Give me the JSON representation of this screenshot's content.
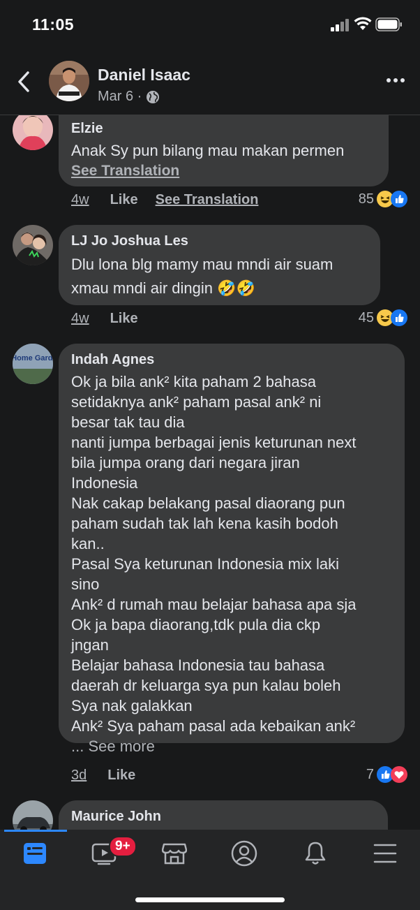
{
  "status": {
    "time": "11:05"
  },
  "header": {
    "name": "Daniel Isaac",
    "date": "Mar 6 ·"
  },
  "comments": [
    {
      "author": "Elzie",
      "text": "Anak Sy pun bilang mau makan permen",
      "see_translation": "See Translation",
      "time": "4w",
      "like": "Like",
      "translate": "See Translation",
      "reactions": "85"
    },
    {
      "author": "LJ Jo Joshua Les",
      "text": "Dlu lona blg  mamy mau mndi air suam\nxmau mndi air dingin 🤣🤣",
      "time": "4w",
      "like": "Like",
      "reactions": "45"
    },
    {
      "author": "Indah Agnes",
      "text": "Ok ja bila ank² kita paham 2 bahasa\nsetidaknya ank² paham pasal ank² ni\nbesar tak tau dia\nnanti jumpa berbagai jenis keturunan next\nbila jumpa orang dari negara jiran\nIndonesia\nNak cakap belakang pasal diaorang pun\npaham sudah tak lah kena kasih bodoh\nkan..\nPasal Sya keturunan Indonesia mix laki\nsino\nAnk² d rumah mau belajar bahasa apa sja\nOk ja bapa diaorang,tdk pula dia ckp\njngan\nBelajar bahasa Indonesia tau bahasa\ndaerah dr keluarga sya pun kalau boleh\nSya nak galakkan\nAnk² Sya paham pasal ada kebaikan ank²",
      "see_more": "... See more",
      "avatar_text": "A Home Garden",
      "time": "3d",
      "like": "Like",
      "reactions": "7"
    },
    {
      "author": "Maurice John"
    }
  ],
  "nav": {
    "badge": "9+"
  },
  "colors": {
    "accent": "#2d88ff",
    "like_blue": "#1877f2",
    "love_red": "#f33e58",
    "badge_red": "#e41e3f"
  }
}
